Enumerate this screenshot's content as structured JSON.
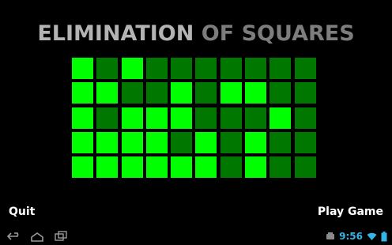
{
  "title": {
    "part1": "ELIMINATION",
    "part2": "OF SQUARES"
  },
  "grid": {
    "rows": 5,
    "cols": 10,
    "cells": [
      [
        1,
        0,
        1,
        0,
        0,
        0,
        0,
        0,
        0,
        0
      ],
      [
        1,
        1,
        0,
        0,
        1,
        0,
        1,
        1,
        0,
        0
      ],
      [
        1,
        0,
        1,
        1,
        1,
        0,
        0,
        0,
        1,
        0
      ],
      [
        1,
        1,
        1,
        1,
        0,
        1,
        0,
        1,
        0,
        0
      ],
      [
        1,
        1,
        1,
        1,
        1,
        1,
        0,
        1,
        0,
        0
      ]
    ],
    "color_on": "#00ff00",
    "color_off": "#007800"
  },
  "buttons": {
    "quit": "Quit",
    "play": "Play Game"
  },
  "navbar": {
    "icons": [
      "back-icon",
      "home-icon",
      "recent-apps-icon"
    ],
    "status_icons": [
      "notification-icon",
      "wifi-icon",
      "battery-icon"
    ],
    "time": "9:56"
  },
  "colors": {
    "background": "#000000",
    "title_primary": "#b3b3b3",
    "title_secondary": "#7d7d7d",
    "clock": "#33b5e5"
  }
}
